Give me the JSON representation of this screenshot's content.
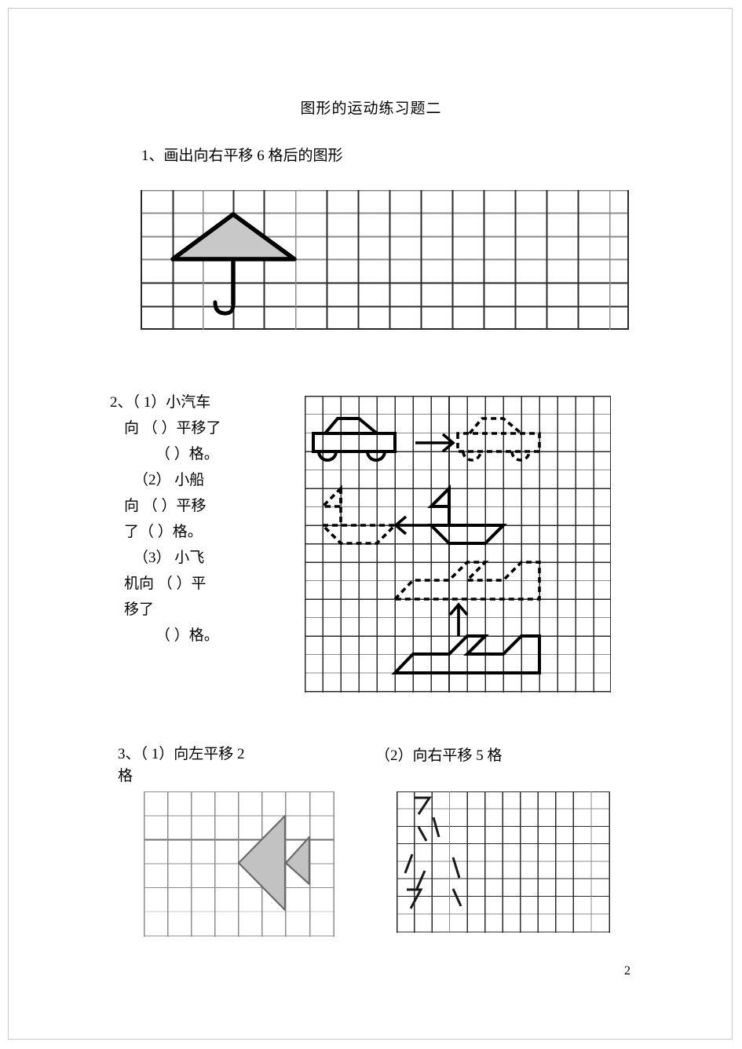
{
  "document": {
    "title": "图形的运动练习题二",
    "page_number": "2"
  },
  "questions": {
    "q1": {
      "text": "1、画出向右平移 6 格后的图形",
      "grid": {
        "cols": 15,
        "rows": 6
      },
      "shape": "umbrella"
    },
    "q2": {
      "lines": [
        "2、（ 1）小汽车",
        "向 （ ）平移了",
        "（ ）格。",
        "（2） 小船",
        "向 （ ）平移",
        "了（ ）格。",
        "（3） 小飞",
        "机向 （ ）平",
        "移了",
        "（ ）格。"
      ],
      "grid": {
        "cols": 17,
        "rows": 16
      },
      "shapes": [
        "car",
        "boat",
        "airplane"
      ],
      "arrows": [
        "right-arrow",
        "left-arrow",
        "up-arrow"
      ]
    },
    "q3": {
      "left_text_line1": "3、（ 1）向左平移 2",
      "left_text_line2": "格",
      "right_text": "（2）向右平移 5 格",
      "left_grid": {
        "cols": 8,
        "rows": 6
      },
      "right_grid": {
        "cols": 12,
        "rows": 8
      },
      "left_shape": "fish-triangles",
      "right_shape": "partial-strokes"
    }
  },
  "colors": {
    "ink": "#000000",
    "grid_dark": "#2b2b2b",
    "grid_light": "#8c8c8c",
    "shape_fill": "#c8c8c8",
    "page_border": "#c9c9c9"
  }
}
